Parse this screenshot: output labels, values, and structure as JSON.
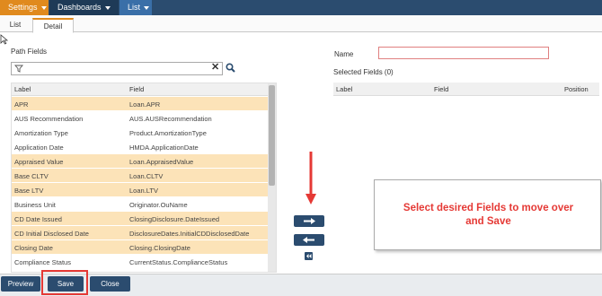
{
  "nav": {
    "settings": "Settings",
    "dashboards": "Dashboards",
    "list": "List"
  },
  "tabs": {
    "list": "List",
    "detail": "Detail"
  },
  "left": {
    "title": "Path Fields",
    "search_value": "",
    "columns": {
      "label": "Label",
      "field": "Field"
    },
    "rows": [
      {
        "label": "APR",
        "field": "Loan.APR",
        "selected": true
      },
      {
        "label": "AUS Recommendation",
        "field": "AUS.AUSRecommendation",
        "selected": false
      },
      {
        "label": "Amortization Type",
        "field": "Product.AmortizationType",
        "selected": false
      },
      {
        "label": "Application Date",
        "field": "HMDA.ApplicationDate",
        "selected": false
      },
      {
        "label": "Appraised Value",
        "field": "Loan.AppraisedValue",
        "selected": true
      },
      {
        "label": "Base CLTV",
        "field": "Loan.CLTV",
        "selected": true
      },
      {
        "label": "Base LTV",
        "field": "Loan.LTV",
        "selected": true
      },
      {
        "label": "Business Unit",
        "field": "Originator.OuName",
        "selected": false
      },
      {
        "label": "CD Date Issued",
        "field": "ClosingDisclosure.DateIssued",
        "selected": true
      },
      {
        "label": "CD Initial Disclosed Date",
        "field": "DisclosureDates.InitialCDDisclosedDate",
        "selected": true
      },
      {
        "label": "Closing Date",
        "field": "Closing.ClosingDate",
        "selected": true
      },
      {
        "label": "Compliance Status",
        "field": "CurrentStatus.ComplianceStatus",
        "selected": false
      }
    ]
  },
  "right": {
    "name_label": "Name",
    "name_value": "",
    "selected_title": "Selected Fields (0)",
    "columns": {
      "label": "Label",
      "field": "Field",
      "position": "Position"
    }
  },
  "callout": {
    "line1": "Select desired Fields to move over",
    "line2": "and Save"
  },
  "footer": {
    "preview": "Preview",
    "save": "Save",
    "close": "Close"
  },
  "colors": {
    "nav": "#2b4c6f",
    "accent": "#e08a1e",
    "selected_row": "#fce3b8",
    "annotation_red": "#e53935"
  }
}
